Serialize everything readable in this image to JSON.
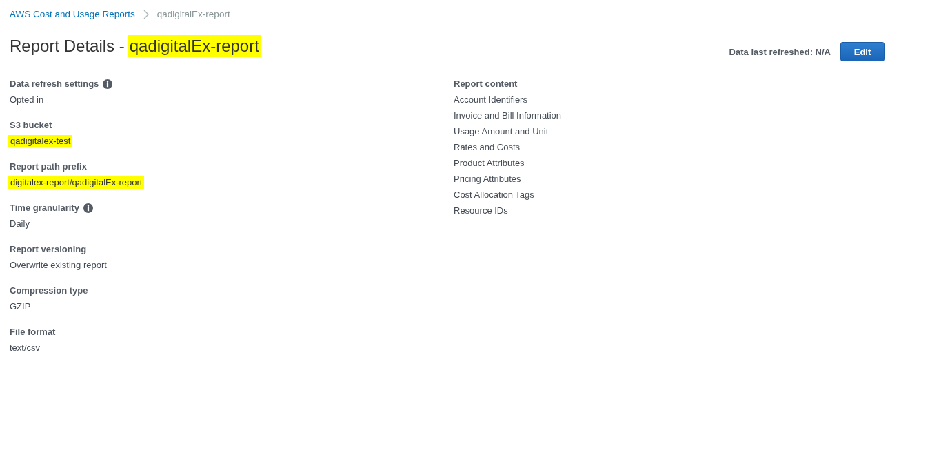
{
  "breadcrumb": [
    {
      "label": "AWS Cost and Usage Reports",
      "kind": "link"
    },
    {
      "label": "qadigitalEx-report",
      "kind": "current"
    }
  ],
  "header": {
    "title": "Report Details -",
    "report_name": "qadigitalEx-report",
    "report_name_highlighted": true,
    "refreshed": "Data last refreshed: N/A",
    "edit_button": "Edit"
  },
  "details": [
    {
      "label": "Data refresh settings",
      "info": true,
      "value": "Opted in",
      "highlighted": false
    },
    {
      "label": "S3 bucket",
      "info": false,
      "value": "qadigitalex-test",
      "highlighted": true
    },
    {
      "label": "Report path prefix",
      "info": false,
      "value": "digitalex-report/qadigitalEx-report",
      "highlighted": true
    },
    {
      "label": "Time granularity",
      "info": true,
      "value": "Daily",
      "highlighted": false
    },
    {
      "label": "Report versioning",
      "info": false,
      "value": "Overwrite existing report",
      "highlighted": false
    },
    {
      "label": "Compression type",
      "info": false,
      "value": "GZIP",
      "highlighted": false
    },
    {
      "label": "File format",
      "info": false,
      "value": "text/csv",
      "highlighted": false
    }
  ],
  "report_content": {
    "heading": "Report content",
    "items": [
      "Account Identifiers",
      "Invoice and Bill Information",
      "Usage Amount and Unit",
      "Rates and Costs",
      "Product Attributes",
      "Pricing Attributes",
      "Cost Allocation Tags",
      "Resource IDs"
    ]
  }
}
